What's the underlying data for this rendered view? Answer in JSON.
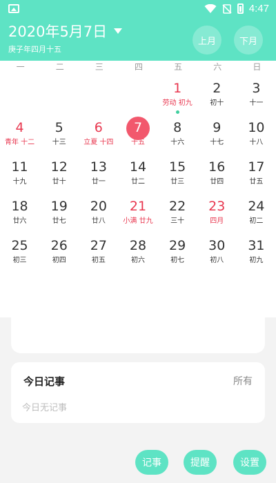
{
  "status_bar": {
    "time": "4:47"
  },
  "header": {
    "date_title": "2020年5月7日",
    "lunar_subtitle": "庚子年四月十五",
    "prev_month_label": "上月",
    "next_month_label": "下月"
  },
  "weekdays": [
    "一",
    "二",
    "三",
    "四",
    "五",
    "六",
    "日"
  ],
  "days": [
    {
      "num": "",
      "lunar": ""
    },
    {
      "num": "",
      "lunar": ""
    },
    {
      "num": "",
      "lunar": ""
    },
    {
      "num": "",
      "lunar": ""
    },
    {
      "num": "1",
      "lunar": "劳动 初九",
      "red": true,
      "dot": true
    },
    {
      "num": "2",
      "lunar": "初十"
    },
    {
      "num": "3",
      "lunar": "十一"
    },
    {
      "num": "4",
      "lunar": "青年 十二",
      "red": true
    },
    {
      "num": "5",
      "lunar": "十三"
    },
    {
      "num": "6",
      "lunar": "立夏 十四",
      "red": true
    },
    {
      "num": "7",
      "lunar": "十五",
      "today": true
    },
    {
      "num": "8",
      "lunar": "十六"
    },
    {
      "num": "9",
      "lunar": "十七"
    },
    {
      "num": "10",
      "lunar": "十八"
    },
    {
      "num": "11",
      "lunar": "十九"
    },
    {
      "num": "12",
      "lunar": "廿十"
    },
    {
      "num": "13",
      "lunar": "廿一"
    },
    {
      "num": "14",
      "lunar": "廿二"
    },
    {
      "num": "15",
      "lunar": "廿三"
    },
    {
      "num": "16",
      "lunar": "廿四"
    },
    {
      "num": "17",
      "lunar": "廿五"
    },
    {
      "num": "18",
      "lunar": "廿六"
    },
    {
      "num": "19",
      "lunar": "廿七"
    },
    {
      "num": "20",
      "lunar": "廿八"
    },
    {
      "num": "21",
      "lunar": "小满 廿九",
      "red": true
    },
    {
      "num": "22",
      "lunar": "三十"
    },
    {
      "num": "23",
      "lunar": "四月",
      "red": true
    },
    {
      "num": "24",
      "lunar": "初二"
    },
    {
      "num": "25",
      "lunar": "初三"
    },
    {
      "num": "26",
      "lunar": "初四"
    },
    {
      "num": "27",
      "lunar": "初五"
    },
    {
      "num": "28",
      "lunar": "初六"
    },
    {
      "num": "29",
      "lunar": "初七"
    },
    {
      "num": "30",
      "lunar": "初八"
    },
    {
      "num": "31",
      "lunar": "初九"
    }
  ],
  "memo": {
    "title": "今日记事",
    "all_label": "所有",
    "empty_text": "今日无记事"
  },
  "actions": {
    "note_label": "记事",
    "remind_label": "提醒",
    "settings_label": "设置"
  },
  "colors": {
    "accent": "#5ee3c4",
    "holiday_red": "#e8374f",
    "today_circle": "#f2586d"
  }
}
